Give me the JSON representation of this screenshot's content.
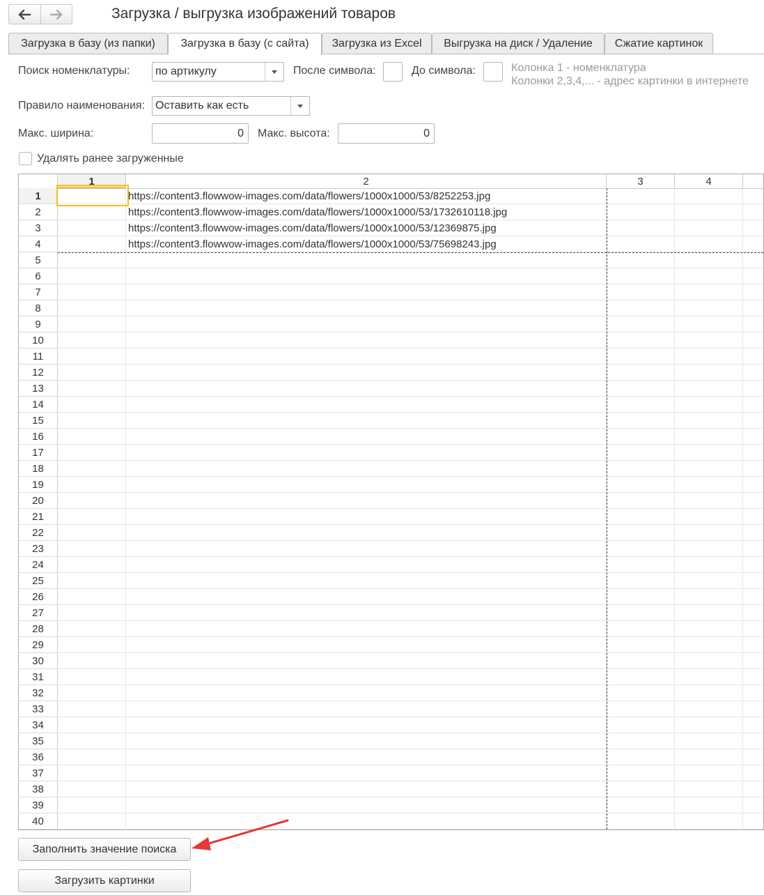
{
  "title": "Загрузка / выгрузка изображений товаров",
  "nav": {
    "back_icon": "arrow-left-icon",
    "forward_icon": "arrow-right-icon"
  },
  "tabs": [
    {
      "label": "Загрузка в базу (из папки)",
      "active": false
    },
    {
      "label": "Загрузка в базу (с сайта)",
      "active": true
    },
    {
      "label": "Загрузка из Excel",
      "active": false
    },
    {
      "label": "Выгрузка на диск / Удаление",
      "active": false
    },
    {
      "label": "Сжатие картинок",
      "active": false
    }
  ],
  "form": {
    "search_label": "Поиск номенклатуры:",
    "search_value": "по артикулу",
    "after_symbol_label": "После символа:",
    "after_symbol_value": "",
    "before_symbol_label": "До символа:",
    "before_symbol_value": "",
    "hint_line1": "Колонка 1 - номенклатура",
    "hint_line2": "Колонки 2,3,4,... - адрес картинки в интернете",
    "naming_label": "Правило наименования:",
    "naming_value": "Оставить как есть",
    "max_width_label": "Макс. ширина:",
    "max_width_value": "0",
    "max_height_label": "Макс. высота:",
    "max_height_value": "0",
    "delete_prev_label": "Удалять ранее загруженные",
    "delete_prev_checked": false
  },
  "sheet": {
    "columns": [
      "1",
      "2",
      "3",
      "4"
    ],
    "selected_cell": {
      "row": 1,
      "col": 1
    },
    "row_count": 40,
    "rows": [
      [
        "",
        "https://content3.flowwow-images.com/data/flowers/1000x1000/53/8252253.jpg",
        "",
        ""
      ],
      [
        "",
        "https://content3.flowwow-images.com/data/flowers/1000x1000/53/1732610118.jpg",
        "",
        ""
      ],
      [
        "",
        "https://content3.flowwow-images.com/data/flowers/1000x1000/53/12369875.jpg",
        "",
        ""
      ],
      [
        "",
        "https://content3.flowwow-images.com/data/flowers/1000x1000/53/75698243.jpg",
        "",
        ""
      ]
    ]
  },
  "buttons": {
    "fill_search": "Заполнить значение поиска",
    "load_images": "Загрузить картинки"
  },
  "annotation": {
    "arrow_color": "#e53935"
  }
}
